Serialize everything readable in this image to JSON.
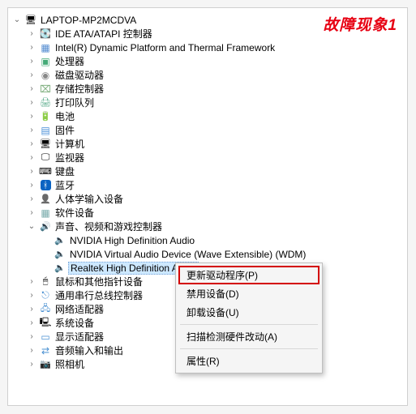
{
  "badge": "故障现象1",
  "root": {
    "label": "LAPTOP-MP2MCDVA"
  },
  "nodes": [
    {
      "label": "IDE ATA/ATAPI 控制器",
      "iconClass": "i-ide",
      "expander": "›"
    },
    {
      "label": "Intel(R) Dynamic Platform and Thermal Framework",
      "iconClass": "i-chip",
      "expander": "›"
    },
    {
      "label": "处理器",
      "iconClass": "i-cpu",
      "expander": "›"
    },
    {
      "label": "磁盘驱动器",
      "iconClass": "i-disc",
      "expander": "›"
    },
    {
      "label": "存储控制器",
      "iconClass": "i-disk",
      "expander": "›"
    },
    {
      "label": "打印队列",
      "iconClass": "i-printq",
      "expander": "›"
    },
    {
      "label": "电池",
      "iconClass": "i-batt",
      "expander": "›"
    },
    {
      "label": "固件",
      "iconClass": "i-firm",
      "expander": "›"
    },
    {
      "label": "计算机",
      "iconClass": "i-comp",
      "expander": "›"
    },
    {
      "label": "监视器",
      "iconClass": "i-mon",
      "expander": "›"
    },
    {
      "label": "键盘",
      "iconClass": "i-kbd",
      "expander": "›"
    },
    {
      "label": "蓝牙",
      "iconClass": "i-bt",
      "expander": "›"
    },
    {
      "label": "人体学输入设备",
      "iconClass": "i-hid",
      "expander": "›"
    },
    {
      "label": "软件设备",
      "iconClass": "i-soft",
      "expander": "›"
    },
    {
      "label": "声音、视频和游戏控制器",
      "iconClass": "i-snd",
      "expander": "⌄",
      "children": [
        {
          "label": "NVIDIA High Definition Audio",
          "iconClass": "i-spk"
        },
        {
          "label": "NVIDIA Virtual Audio Device (Wave Extensible) (WDM)",
          "iconClass": "i-spk"
        },
        {
          "label": "Realtek High Definition Audio",
          "iconClass": "i-spk",
          "selected": true
        }
      ]
    },
    {
      "label": "鼠标和其他指针设备",
      "iconClass": "i-mouse",
      "expander": "›"
    },
    {
      "label": "通用串行总线控制器",
      "iconClass": "i-usb",
      "expander": "›"
    },
    {
      "label": "网络适配器",
      "iconClass": "i-net",
      "expander": "›"
    },
    {
      "label": "系统设备",
      "iconClass": "i-sys",
      "expander": "›"
    },
    {
      "label": "显示适配器",
      "iconClass": "i-disp",
      "expander": "›"
    },
    {
      "label": "音频输入和输出",
      "iconClass": "i-aio",
      "expander": "›"
    },
    {
      "label": "照相机",
      "iconClass": "i-cam",
      "expander": "›"
    }
  ],
  "contextMenu": {
    "items": [
      {
        "label": "更新驱动程序(P)",
        "highlighted": true
      },
      {
        "label": "禁用设备(D)"
      },
      {
        "label": "卸载设备(U)"
      },
      {
        "sep": true
      },
      {
        "label": "扫描检测硬件改动(A)"
      },
      {
        "sep": true
      },
      {
        "label": "属性(R)"
      }
    ]
  }
}
